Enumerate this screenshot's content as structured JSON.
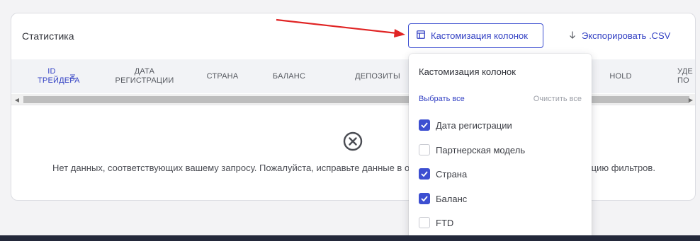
{
  "card": {
    "title": "Статистика",
    "customize_button": "Кастомизация колонок",
    "export_button": "Экспорировать .CSV"
  },
  "table": {
    "columns": [
      {
        "label": "ID ТРЕЙДЕРА",
        "active": true
      },
      {
        "label": "ДАТА РЕГИСТРАЦИИ"
      },
      {
        "label": "СТРАНА"
      },
      {
        "label": "БАЛАНС"
      },
      {
        "label": "ДЕПОЗИТЫ"
      },
      {
        "label": "HOLD"
      },
      {
        "label": "УДЕ ПО"
      }
    ],
    "empty_message": "Нет данных, соответствующих вашему запросу. Пожалуйста, исправьте данные в о                                                                     ацию фильтров."
  },
  "dropdown": {
    "title": "Кастомизация колонок",
    "select_all": "Выбрать все",
    "clear_all": "Очистить все",
    "items": [
      {
        "label": "Дата регистрации",
        "checked": true
      },
      {
        "label": "Партнерская модель",
        "checked": false
      },
      {
        "label": "Страна",
        "checked": true
      },
      {
        "label": "Баланс",
        "checked": true
      },
      {
        "label": "FTD",
        "checked": false
      }
    ]
  },
  "colors": {
    "accent": "#3d4fd1",
    "annotation_arrow": "#e02424",
    "footer": "#23283a"
  }
}
